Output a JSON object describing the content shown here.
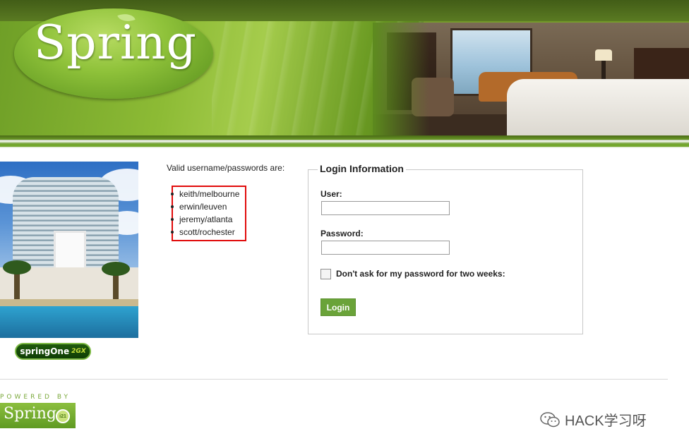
{
  "header": {
    "logo_text": "Spring"
  },
  "left": {
    "badge_main": "springOne",
    "badge_suffix": "2GX"
  },
  "credentials": {
    "intro": "Valid username/passwords are:",
    "items": [
      {
        "text": "keith/melbourne"
      },
      {
        "text": "erwin/leuven"
      },
      {
        "text": "jeremy/atlanta"
      },
      {
        "text": "scott/rochester"
      }
    ]
  },
  "login": {
    "legend": "Login Information",
    "user_label": "User:",
    "user_value": "",
    "password_label": "Password:",
    "password_value": "",
    "remember_label": "Don't ask for my password for two weeks:",
    "remember_checked": false,
    "submit_label": "Login"
  },
  "footer": {
    "powered_by": "POWERED BY",
    "logo_text": "Spring",
    "i21_text": "i21"
  },
  "watermark": {
    "text": "HACK学习呀"
  },
  "colors": {
    "brand_green": "#6aa339",
    "highlight_red": "#e10b0b"
  }
}
